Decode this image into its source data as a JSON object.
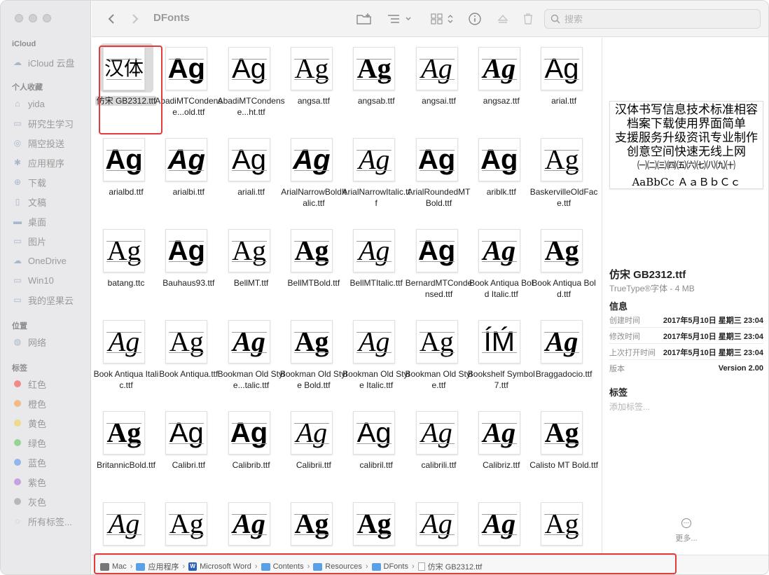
{
  "toolbar": {
    "title": "DFonts",
    "search_placeholder": "搜索"
  },
  "sidebar": {
    "sections": [
      {
        "label": "iCloud",
        "items": [
          {
            "label": "iCloud 云盘",
            "icon": "cloud-icon"
          }
        ]
      },
      {
        "label": "个人收藏",
        "items": [
          {
            "label": "yida",
            "icon": "home-icon"
          },
          {
            "label": "研究生学习",
            "icon": "folder-icon"
          },
          {
            "label": "隔空投送",
            "icon": "airdrop-icon"
          },
          {
            "label": "应用程序",
            "icon": "apps-icon"
          },
          {
            "label": "下载",
            "icon": "download-icon"
          },
          {
            "label": "文稿",
            "icon": "document-icon"
          },
          {
            "label": "桌面",
            "icon": "desktop-icon"
          },
          {
            "label": "图片",
            "icon": "folder-icon"
          },
          {
            "label": "OneDrive",
            "icon": "cloud-icon"
          },
          {
            "label": "Win10",
            "icon": "folder-icon"
          },
          {
            "label": "我的坚果云",
            "icon": "folder-icon"
          }
        ]
      },
      {
        "label": "位置",
        "items": [
          {
            "label": "网络",
            "icon": "network-icon"
          }
        ]
      },
      {
        "label": "标签",
        "items": [
          {
            "label": "红色",
            "color": "#f08a8a"
          },
          {
            "label": "橙色",
            "color": "#f3b98a"
          },
          {
            "label": "黄色",
            "color": "#efd98a"
          },
          {
            "label": "绿色",
            "color": "#96d496"
          },
          {
            "label": "蓝色",
            "color": "#8fb6ef"
          },
          {
            "label": "紫色",
            "color": "#c9a0e2"
          },
          {
            "label": "灰色",
            "color": "#b8b8b8"
          },
          {
            "label": "所有标签...",
            "icon": "tags-icon"
          }
        ]
      }
    ]
  },
  "files": [
    {
      "name": "仿宋 GB2312.ttf",
      "glyph": "汉体",
      "selected": true
    },
    {
      "name": "AbadiMTCondense...old.ttf",
      "glyph": "Ag"
    },
    {
      "name": "AbadiMTCondense...ht.ttf",
      "glyph": "Ag"
    },
    {
      "name": "angsa.ttf",
      "glyph": "Ag"
    },
    {
      "name": "angsab.ttf",
      "glyph": "Ag"
    },
    {
      "name": "angsai.ttf",
      "glyph": "Ag"
    },
    {
      "name": "angsaz.ttf",
      "glyph": "Ag"
    },
    {
      "name": "arial.ttf",
      "glyph": "Ag"
    },
    {
      "name": "arialbd.ttf",
      "glyph": "Ag"
    },
    {
      "name": "arialbi.ttf",
      "glyph": "Ag"
    },
    {
      "name": "ariali.ttf",
      "glyph": "Ag"
    },
    {
      "name": "ArialNarrowBoldItalic.ttf",
      "glyph": "Ag"
    },
    {
      "name": "ArialNarrowItalic.ttf",
      "glyph": "Ag"
    },
    {
      "name": "ArialRoundedMTBold.ttf",
      "glyph": "Ag"
    },
    {
      "name": "ariblk.ttf",
      "glyph": "Ag"
    },
    {
      "name": "BaskervilleOldFace.ttf",
      "glyph": "Ag"
    },
    {
      "name": "batang.ttc",
      "glyph": "Ag"
    },
    {
      "name": "Bauhaus93.ttf",
      "glyph": "Ag"
    },
    {
      "name": "BellMT.ttf",
      "glyph": "Ag"
    },
    {
      "name": "BellMTBold.ttf",
      "glyph": "Ag"
    },
    {
      "name": "BellMTItalic.ttf",
      "glyph": "Ag"
    },
    {
      "name": "BernardMTCondensed.ttf",
      "glyph": "Ag"
    },
    {
      "name": "Book Antiqua Bold Italic.ttf",
      "glyph": "Ag"
    },
    {
      "name": "Book Antiqua Bold.ttf",
      "glyph": "Ag"
    },
    {
      "name": "Book Antiqua Italic.ttf",
      "glyph": "Ag"
    },
    {
      "name": "Book Antiqua.ttf",
      "glyph": "Ag"
    },
    {
      "name": "Bookman Old Style...talic.ttf",
      "glyph": "Ag"
    },
    {
      "name": "Bookman Old Style Bold.ttf",
      "glyph": "Ag"
    },
    {
      "name": "Bookman Old Style Italic.ttf",
      "glyph": "Ag"
    },
    {
      "name": "Bookman Old Style.ttf",
      "glyph": "Ag"
    },
    {
      "name": "Bookshelf Symbol 7.ttf",
      "glyph": "ÍḾ"
    },
    {
      "name": "Braggadocio.ttf",
      "glyph": "Ag"
    },
    {
      "name": "BritannicBold.ttf",
      "glyph": "Ag"
    },
    {
      "name": "Calibri.ttf",
      "glyph": "Ag"
    },
    {
      "name": "Calibrib.ttf",
      "glyph": "Ag"
    },
    {
      "name": "Calibrii.ttf",
      "glyph": "Ag"
    },
    {
      "name": "calibril.ttf",
      "glyph": "Ag"
    },
    {
      "name": "calibrili.ttf",
      "glyph": "Ag"
    },
    {
      "name": "Calibriz.ttf",
      "glyph": "Ag"
    },
    {
      "name": "Calisto MT Bold.ttf",
      "glyph": "Ag"
    },
    {
      "name": "",
      "glyph": "Ag"
    },
    {
      "name": "",
      "glyph": "Ag"
    },
    {
      "name": "",
      "glyph": "Ag"
    },
    {
      "name": "",
      "glyph": "Ag"
    },
    {
      "name": "",
      "glyph": "Ag"
    },
    {
      "name": "",
      "glyph": "Ag"
    },
    {
      "name": "",
      "glyph": "Ag"
    },
    {
      "name": "",
      "glyph": "Ag"
    }
  ],
  "preview": {
    "sample_lines": [
      "汉体书写信息技术标准相容",
      "档案下载使用界面简单",
      "支援服务升级资讯专业制作",
      "创意空间快速无线上网",
      "㈠㈡㈢㈣㈤㈥㈦㈧㈨㈩",
      "AaBbCc ＡａＢｂＣｃ"
    ],
    "title": "仿宋 GB2312.ttf",
    "subtitle": "TrueType®字体 - 4 MB",
    "info_heading": "信息",
    "info": [
      {
        "key": "创建时间",
        "value": "2017年5月10日 星期三 23:04"
      },
      {
        "key": "修改时间",
        "value": "2017年5月10日 星期三 23:04"
      },
      {
        "key": "上次打开时间",
        "value": "2017年5月10日 星期三 23:04"
      },
      {
        "key": "版本",
        "value": "Version 2.00"
      }
    ],
    "tags_heading": "标签",
    "add_tag": "添加标签...",
    "more_label": "更多..."
  },
  "path": [
    {
      "label": "Mac",
      "icon": "disk-icon"
    },
    {
      "label": "应用程序",
      "icon": "folder-icon"
    },
    {
      "label": "Microsoft Word",
      "icon": "word-app-icon"
    },
    {
      "label": "Contents",
      "icon": "folder-icon"
    },
    {
      "label": "Resources",
      "icon": "folder-icon"
    },
    {
      "label": "DFonts",
      "icon": "folder-icon"
    },
    {
      "label": "仿宋 GB2312.ttf",
      "icon": "document-icon"
    }
  ],
  "colors": {
    "highlight": "#e23b3b",
    "sidebar_bg": "#e9e8ea",
    "folder_blue": "#5aa0e6"
  }
}
